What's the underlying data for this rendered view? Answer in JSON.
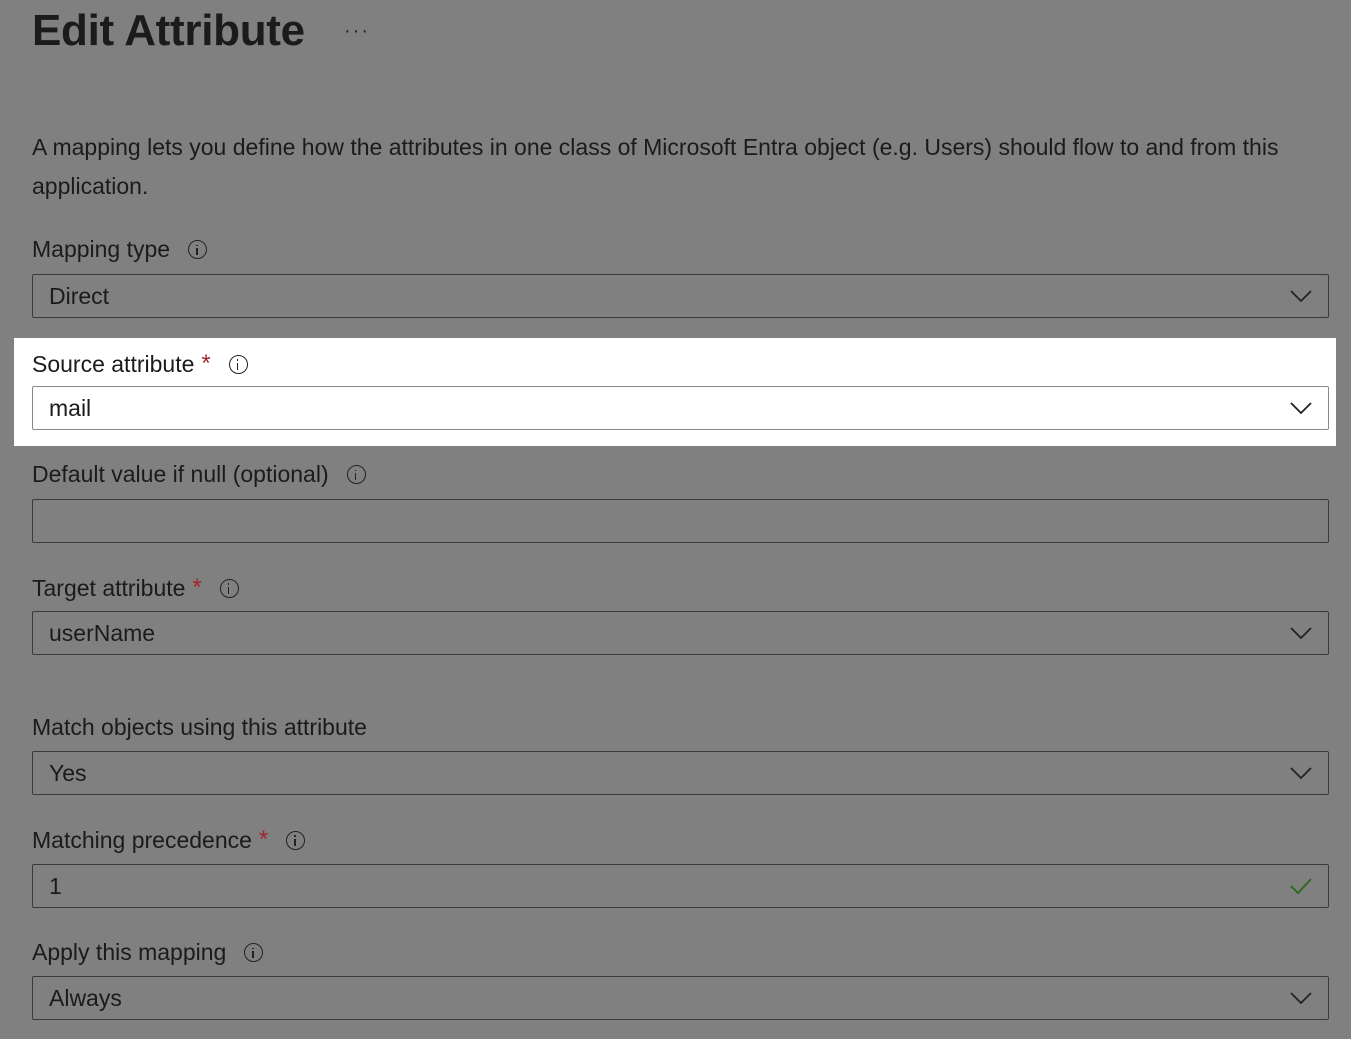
{
  "page": {
    "title": "Edit Attribute",
    "more_label": "···",
    "description": "A mapping lets you define how the attributes in one class of Microsoft Entra object (e.g. Users) should flow to and from this application."
  },
  "fields": {
    "mapping_type": {
      "label": "Mapping type",
      "value": "Direct"
    },
    "source_attribute": {
      "label": "Source attribute",
      "required_mark": "*",
      "value": "mail"
    },
    "default_value": {
      "label": "Default value if null (optional)",
      "value": ""
    },
    "target_attribute": {
      "label": "Target attribute",
      "required_mark": "*",
      "value": "userName"
    },
    "match_objects": {
      "label": "Match objects using this attribute",
      "value": "Yes"
    },
    "matching_precedence": {
      "label": "Matching precedence",
      "required_mark": "*",
      "value": "1"
    },
    "apply_mapping": {
      "label": "Apply this mapping",
      "value": "Always"
    }
  },
  "colors": {
    "overlay": "#808080",
    "highlight": "#ffffff",
    "required": "#a4262c",
    "valid_check": "#2e6b1f"
  },
  "icons": {
    "info": "info-icon",
    "dropdown": "chevron-down-icon",
    "valid": "checkmark-icon",
    "more": "more-icon"
  }
}
